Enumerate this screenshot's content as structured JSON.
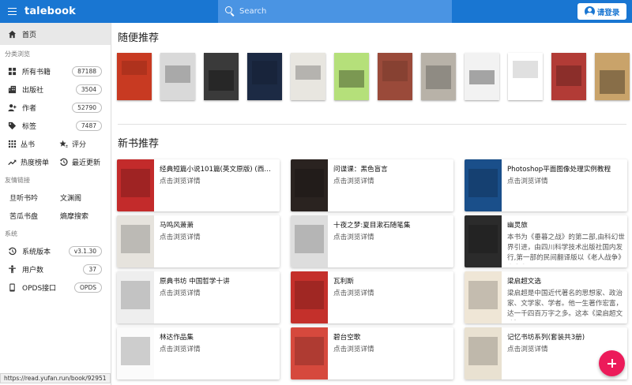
{
  "header": {
    "title": "talebook",
    "search_placeholder": "Search",
    "login_label": "请登录"
  },
  "sidebar": {
    "home": "首页",
    "categories_title": "分类浏览",
    "categories": [
      {
        "label": "所有书籍",
        "count": "87188",
        "icon": "grid-icon"
      },
      {
        "label": "出版社",
        "count": "3504",
        "icon": "building-icon"
      },
      {
        "label": "作者",
        "count": "52790",
        "icon": "person-icon"
      },
      {
        "label": "标签",
        "count": "7487",
        "icon": "tag-icon"
      }
    ],
    "pair1": {
      "left": "丛书",
      "right": "评分"
    },
    "pair2": {
      "left": "热度榜单",
      "right": "最近更新"
    },
    "links_title": "友情链接",
    "links": {
      "a": "旦听书吟",
      "b": "文渊阁",
      "c": "苦瓜书盘",
      "d": "熵摩搜索"
    },
    "system_title": "系统",
    "system": [
      {
        "label": "系统版本",
        "value": "v3.1.30",
        "icon": "history-icon"
      },
      {
        "label": "用户数",
        "value": "37",
        "icon": "human-icon"
      },
      {
        "label": "OPDS接口",
        "value": "OPDS",
        "icon": "phone-icon"
      }
    ]
  },
  "main": {
    "random_title": "随便推荐",
    "new_title": "新书推荐",
    "covers": [
      "#c83a22",
      "#d9d9d9",
      "#3a3a3a",
      "#1c2a44",
      "#e8e6e0",
      "#b5e07a",
      "#9a4a3a",
      "#b8b2a8",
      "#f2f2f2",
      "#ffffff",
      "#b23b36",
      "#c9a36a"
    ],
    "books": [
      {
        "title": "经典短篇小说101篇(英文原版) (西方...",
        "desc": "点击浏览详情"
      },
      {
        "title": "问谍课：黑色盲言",
        "desc": "点击浏览详情"
      },
      {
        "title": "Photoshop平面图像处理实例教程",
        "desc": "点击浏览详情"
      },
      {
        "title": "马鸣风萧萧",
        "desc": "点击浏览详情"
      },
      {
        "title": "十夜之梦:夏目漱石随笔集",
        "desc": "点击浏览详情"
      },
      {
        "title": "幽灵旅",
        "desc": "本书为《垂暮之战》的第二部,由科幻世界引进，由四川科学技术出版社国内发行,第一部的民间翻译版以《老人战争》之名在..."
      },
      {
        "title": "原典书坊 中国哲学十讲",
        "desc": "点击浏览详情"
      },
      {
        "title": "瓦利斯",
        "desc": "点击浏览详情"
      },
      {
        "title": "梁启超文选",
        "desc": "梁启超是中国近代著名的思想家、政治家、文学家、学者。他一生著作宏富，达一千四百万字之多。这本《梁启超文选》..."
      },
      {
        "title": "林达作品集",
        "desc": "点击浏览详情"
      },
      {
        "title": "碧台空歌",
        "desc": "点击浏览详情"
      },
      {
        "title": "记忆书坊系列(套装共3册)",
        "desc": "点击浏览详情"
      }
    ]
  },
  "status": {
    "url": "https://read.yufan.run/book/92951"
  }
}
